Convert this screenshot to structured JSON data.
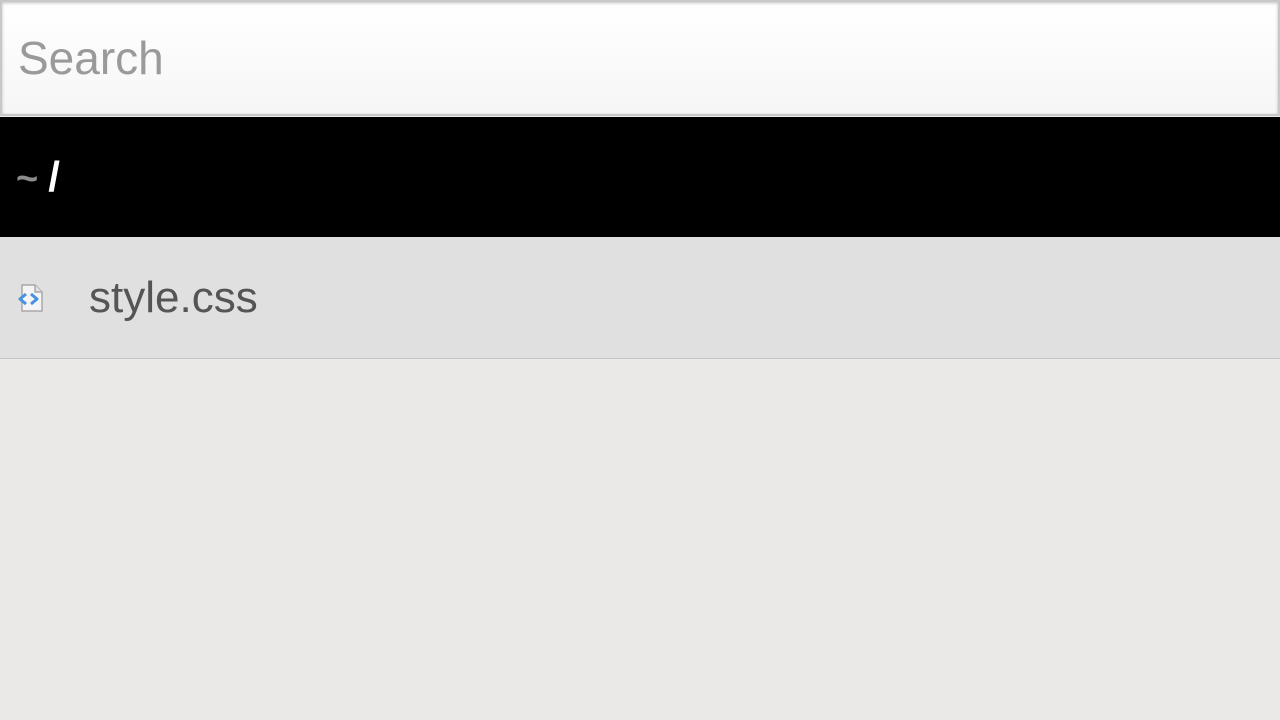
{
  "search": {
    "placeholder": "Search",
    "value": ""
  },
  "path": {
    "home_symbol": "~",
    "current": "/"
  },
  "files": [
    {
      "name": "style.css",
      "icon": "code-file-icon"
    }
  ],
  "colors": {
    "path_bar_bg": "#000000",
    "row_bg": "#e0e0e0",
    "page_bg": "#ebe9e7",
    "icon_accent": "#4a90e2"
  }
}
